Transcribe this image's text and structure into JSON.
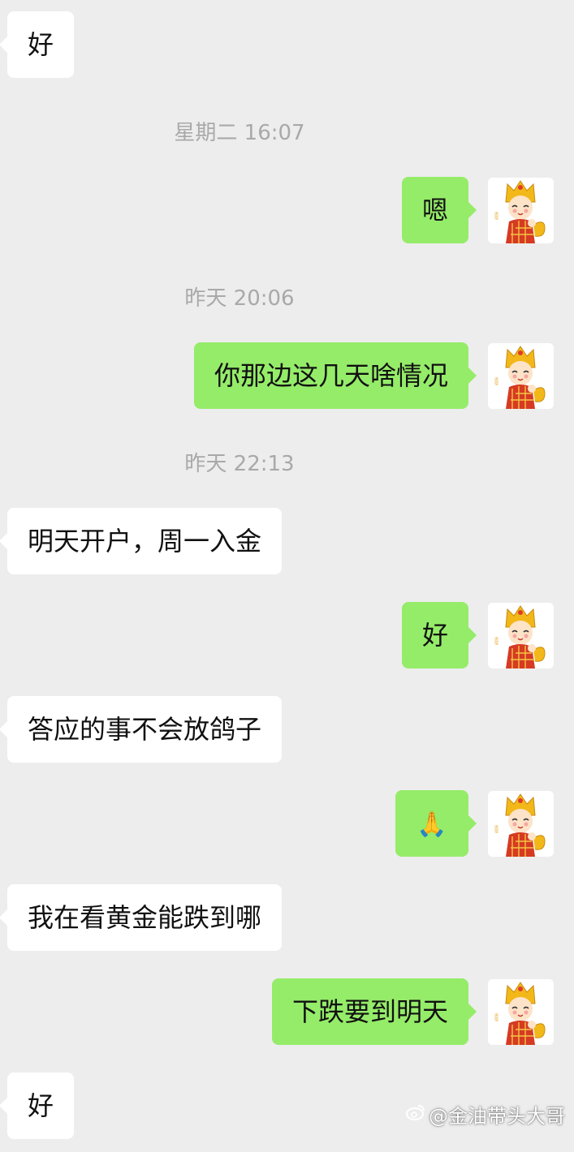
{
  "chat": {
    "items": [
      {
        "kind": "message",
        "side": "in",
        "text": "好"
      },
      {
        "kind": "timestamp",
        "text": "星期二 16:07"
      },
      {
        "kind": "message",
        "side": "out",
        "text": "嗯",
        "avatar": "monk-sticker-avatar"
      },
      {
        "kind": "timestamp",
        "text": "昨天 20:06"
      },
      {
        "kind": "message",
        "side": "out",
        "text": "你那边这几天啥情况",
        "avatar": "monk-sticker-avatar"
      },
      {
        "kind": "timestamp",
        "text": "昨天 22:13"
      },
      {
        "kind": "message",
        "side": "in",
        "text": "明天开户，周一入金"
      },
      {
        "kind": "message",
        "side": "out",
        "text": "好",
        "avatar": "monk-sticker-avatar"
      },
      {
        "kind": "message",
        "side": "in",
        "text": "答应的事不会放鸽子"
      },
      {
        "kind": "message",
        "side": "out",
        "text": "🙏",
        "emoji": "praying-hands-emoji",
        "avatar": "monk-sticker-avatar"
      },
      {
        "kind": "message",
        "side": "in",
        "text": "我在看黄金能跌到哪"
      },
      {
        "kind": "message",
        "side": "out",
        "text": "下跌要到明天",
        "avatar": "monk-sticker-avatar"
      },
      {
        "kind": "message",
        "side": "in",
        "text": "好"
      }
    ]
  },
  "colors": {
    "background": "#ededed",
    "incoming_bubble": "#ffffff",
    "outgoing_bubble": "#95ec69",
    "timestamp_text": "#a9a9a9"
  },
  "watermark": {
    "icon": "weibo-icon",
    "text": "@金油带头大哥"
  }
}
